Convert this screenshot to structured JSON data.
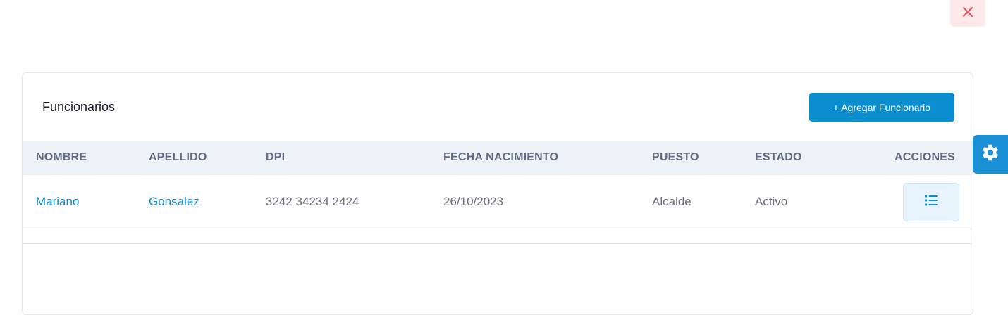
{
  "colors": {
    "accent": "#0b8ecf",
    "close_bg": "#fde8ea",
    "close_icon": "#e7515a",
    "header_bg": "#eef1f6",
    "gear_bg": "#1b8fd6"
  },
  "icons": {
    "close": "close-icon",
    "settings": "gear-icon",
    "actions": "list-icon"
  },
  "card": {
    "title": "Funcionarios",
    "add_button_label": "+ Agregar Funcionario"
  },
  "table": {
    "columns": [
      "NOMBRE",
      "APELLIDO",
      "DPI",
      "FECHA NACIMIENTO",
      "PUESTO",
      "ESTADO",
      "ACCIONES"
    ],
    "rows": [
      {
        "nombre": "Mariano",
        "apellido": "Gonsalez",
        "dpi": "3242 34234 2424",
        "fecha_nacimiento": "26/10/2023",
        "puesto": "Alcalde",
        "estado": "Activo"
      }
    ]
  }
}
